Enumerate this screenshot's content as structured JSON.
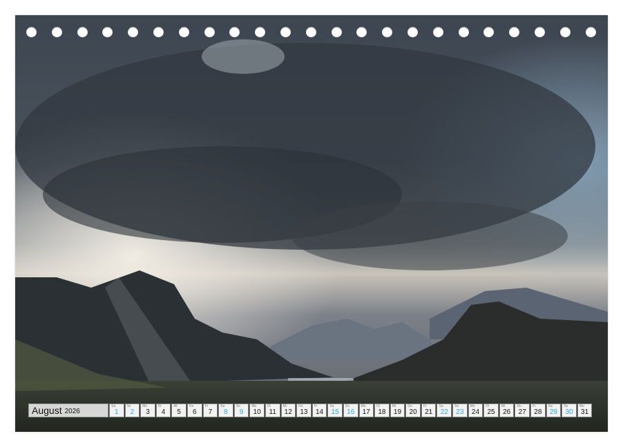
{
  "calendar": {
    "month": "August",
    "year": "2026",
    "days": [
      {
        "num": "1",
        "wd": "Sa",
        "weekend": true
      },
      {
        "num": "2",
        "wd": "So",
        "weekend": true
      },
      {
        "num": "3",
        "wd": "Mo",
        "weekend": false
      },
      {
        "num": "4",
        "wd": "Di",
        "weekend": false
      },
      {
        "num": "5",
        "wd": "Mi",
        "weekend": false
      },
      {
        "num": "6",
        "wd": "Do",
        "weekend": false
      },
      {
        "num": "7",
        "wd": "Fr",
        "weekend": false
      },
      {
        "num": "8",
        "wd": "Sa",
        "weekend": true
      },
      {
        "num": "9",
        "wd": "So",
        "weekend": true
      },
      {
        "num": "10",
        "wd": "Mo",
        "weekend": false
      },
      {
        "num": "11",
        "wd": "Di",
        "weekend": false
      },
      {
        "num": "12",
        "wd": "Mi",
        "weekend": false
      },
      {
        "num": "13",
        "wd": "Do",
        "weekend": false
      },
      {
        "num": "14",
        "wd": "Fr",
        "weekend": false
      },
      {
        "num": "15",
        "wd": "Sa",
        "weekend": true
      },
      {
        "num": "16",
        "wd": "So",
        "weekend": true
      },
      {
        "num": "17",
        "wd": "Mo",
        "weekend": false
      },
      {
        "num": "18",
        "wd": "Di",
        "weekend": false
      },
      {
        "num": "19",
        "wd": "Mi",
        "weekend": false
      },
      {
        "num": "20",
        "wd": "Do",
        "weekend": false
      },
      {
        "num": "21",
        "wd": "Fr",
        "weekend": false
      },
      {
        "num": "22",
        "wd": "Sa",
        "weekend": true
      },
      {
        "num": "23",
        "wd": "So",
        "weekend": true
      },
      {
        "num": "24",
        "wd": "Mo",
        "weekend": false
      },
      {
        "num": "25",
        "wd": "Di",
        "weekend": false
      },
      {
        "num": "26",
        "wd": "Mi",
        "weekend": false
      },
      {
        "num": "27",
        "wd": "Do",
        "weekend": false
      },
      {
        "num": "28",
        "wd": "Fr",
        "weekend": false
      },
      {
        "num": "29",
        "wd": "Sa",
        "weekend": true
      },
      {
        "num": "30",
        "wd": "So",
        "weekend": true
      },
      {
        "num": "31",
        "wd": "Mo",
        "weekend": false
      }
    ]
  },
  "colors": {
    "weekend": "#2aa8d8",
    "weekday": "#111111"
  }
}
